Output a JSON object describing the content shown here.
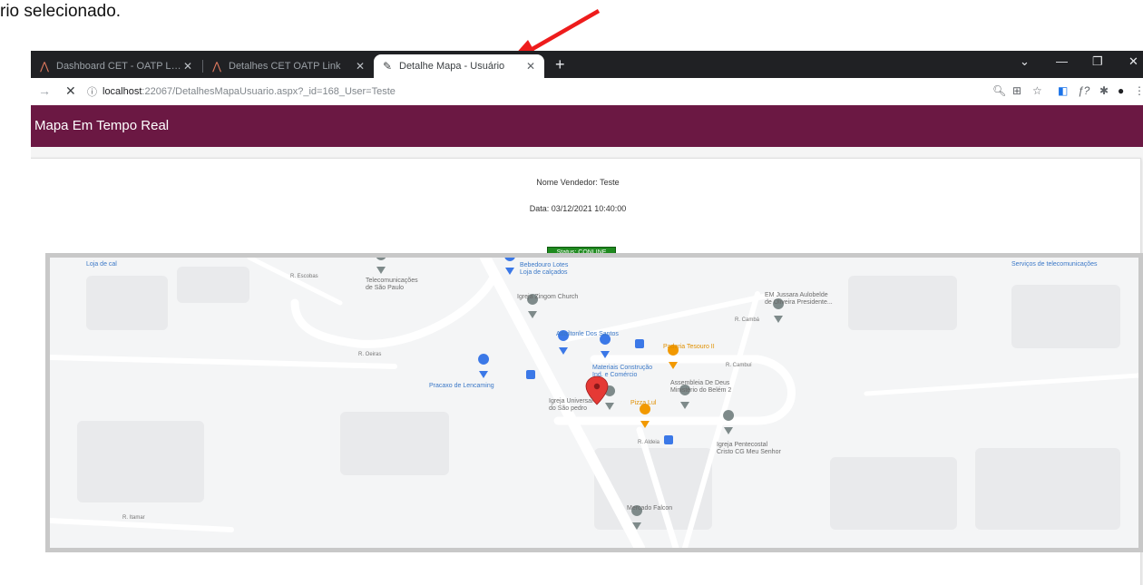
{
  "document": {
    "caption_fragment": "rio selecionado."
  },
  "browser": {
    "tabs": [
      {
        "title": "Dashboard CET - OATP Link",
        "active": false
      },
      {
        "title": "Detalhes CET OATP Link",
        "active": false
      },
      {
        "title": "Detalhe Mapa - Usuário",
        "active": true
      }
    ],
    "url": {
      "host": "localhost",
      "rest": ":22067/DetalhesMapaUsuario.aspx?_id=168_User=Teste"
    }
  },
  "app": {
    "title": "Mapa Em Tempo Real"
  },
  "details": {
    "vendor_line": "Nome Vendedor: Teste",
    "date_line": "Data: 03/12/2021 10:40:00",
    "status_badge": "Status: CONLINE"
  },
  "map": {
    "places": [
      {
        "label": "Bebedouro Lotes",
        "sub": "Loja de calçados",
        "style": "blue"
      },
      {
        "label": "Telecomunicações",
        "sub": "de São Paulo",
        "style": "gray"
      },
      {
        "label": "Igreja Zingom Church",
        "style": "gray"
      },
      {
        "label": "EM Jussara Aulobelde",
        "sub": "de Oliveira Presidente...",
        "style": "gray"
      },
      {
        "label": "Adailtonle Dos Santos",
        "style": "blue"
      },
      {
        "label": "Padaria Tesouro II",
        "style": "orange"
      },
      {
        "label": "Materiais Construção",
        "sub": "Ind. e Comércio",
        "style": "blue"
      },
      {
        "label": "Pracaxo de Lencaming",
        "style": "blue"
      },
      {
        "label": "Assembleia De Deus",
        "sub": "Ministério do Belém 2",
        "style": "gray"
      },
      {
        "label": "Igreja Universal",
        "sub": "do São pedro",
        "style": "gray"
      },
      {
        "label": "Pizza Lul",
        "style": "orange"
      },
      {
        "label": "Igreja Pentecostal",
        "sub": "Cristo CG Meu Senhor",
        "style": "gray"
      },
      {
        "label": "Mercado Falcon",
        "style": "gray"
      }
    ],
    "streets": [
      "R. Escobas",
      "R. Oeiras",
      "R. Cambuí",
      "R. Aldeia",
      "R. Itamar",
      "R. Cambá"
    ],
    "corner_labels": [
      "Loja de cal",
      "Serviços de telecomunicações"
    ]
  },
  "colors": {
    "app_header": "#6b1843",
    "status_green": "#1f8a1f",
    "map_marker": "#e53935"
  }
}
